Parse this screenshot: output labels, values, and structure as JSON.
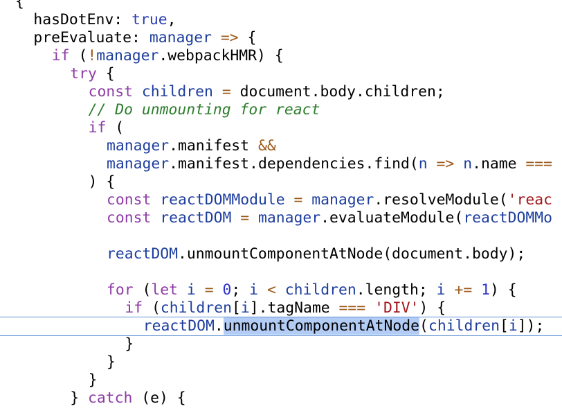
{
  "editor": {
    "colors": {
      "background": "#ffffff",
      "keyword": "#8e3ca6",
      "identifier": "#1d3d9e",
      "atom": "#2c3fb0",
      "operator": "#9c5a1a",
      "number": "#2e33c8",
      "string": "#a0181d",
      "comment": "#2d7d2d",
      "selection": "#b3ccf5",
      "current_line_border": "#5b8fd6"
    },
    "lines": [
      {
        "indent": 0,
        "tokens": [
          {
            "t": "plain",
            "v": "{"
          }
        ]
      },
      {
        "indent": 1,
        "tokens": [
          {
            "t": "plain",
            "v": "hasDotEnv: "
          },
          {
            "t": "atom",
            "v": "true"
          },
          {
            "t": "plain",
            "v": ","
          }
        ]
      },
      {
        "indent": 1,
        "tokens": [
          {
            "t": "plain",
            "v": "preEvaluate: "
          },
          {
            "t": "id",
            "v": "manager"
          },
          {
            "t": "plain",
            "v": " "
          },
          {
            "t": "op",
            "v": "=>"
          },
          {
            "t": "plain",
            "v": " {"
          }
        ]
      },
      {
        "indent": 2,
        "tokens": [
          {
            "t": "kw",
            "v": "if"
          },
          {
            "t": "plain",
            "v": " ("
          },
          {
            "t": "op",
            "v": "!"
          },
          {
            "t": "id",
            "v": "manager"
          },
          {
            "t": "plain",
            "v": ".webpackHMR) {"
          }
        ]
      },
      {
        "indent": 3,
        "tokens": [
          {
            "t": "kw",
            "v": "try"
          },
          {
            "t": "plain",
            "v": " {"
          }
        ]
      },
      {
        "indent": 4,
        "tokens": [
          {
            "t": "kw",
            "v": "const"
          },
          {
            "t": "plain",
            "v": " "
          },
          {
            "t": "id",
            "v": "children"
          },
          {
            "t": "plain",
            "v": " "
          },
          {
            "t": "op",
            "v": "="
          },
          {
            "t": "plain",
            "v": " document.body.children;"
          }
        ]
      },
      {
        "indent": 4,
        "tokens": [
          {
            "t": "cm",
            "v": "// Do unmounting for react"
          }
        ]
      },
      {
        "indent": 4,
        "tokens": [
          {
            "t": "kw",
            "v": "if"
          },
          {
            "t": "plain",
            "v": " ("
          }
        ]
      },
      {
        "indent": 5,
        "tokens": [
          {
            "t": "id",
            "v": "manager"
          },
          {
            "t": "plain",
            "v": ".manifest "
          },
          {
            "t": "op",
            "v": "&&"
          }
        ]
      },
      {
        "indent": 5,
        "tokens": [
          {
            "t": "id",
            "v": "manager"
          },
          {
            "t": "plain",
            "v": ".manifest.dependencies.find("
          },
          {
            "t": "id",
            "v": "n"
          },
          {
            "t": "plain",
            "v": " "
          },
          {
            "t": "op",
            "v": "=>"
          },
          {
            "t": "plain",
            "v": " "
          },
          {
            "t": "id",
            "v": "n"
          },
          {
            "t": "plain",
            "v": ".name "
          },
          {
            "t": "op",
            "v": "==="
          }
        ]
      },
      {
        "indent": 4,
        "tokens": [
          {
            "t": "plain",
            "v": ") {"
          }
        ]
      },
      {
        "indent": 5,
        "tokens": [
          {
            "t": "kw",
            "v": "const"
          },
          {
            "t": "plain",
            "v": " "
          },
          {
            "t": "id",
            "v": "reactDOMModule"
          },
          {
            "t": "plain",
            "v": " "
          },
          {
            "t": "op",
            "v": "="
          },
          {
            "t": "plain",
            "v": " "
          },
          {
            "t": "id",
            "v": "manager"
          },
          {
            "t": "plain",
            "v": ".resolveModule("
          },
          {
            "t": "str",
            "v": "'reac"
          }
        ]
      },
      {
        "indent": 5,
        "tokens": [
          {
            "t": "kw",
            "v": "const"
          },
          {
            "t": "plain",
            "v": " "
          },
          {
            "t": "id",
            "v": "reactDOM"
          },
          {
            "t": "plain",
            "v": " "
          },
          {
            "t": "op",
            "v": "="
          },
          {
            "t": "plain",
            "v": " "
          },
          {
            "t": "id",
            "v": "manager"
          },
          {
            "t": "plain",
            "v": ".evaluateModule("
          },
          {
            "t": "id",
            "v": "reactDOMMo"
          }
        ]
      },
      {
        "indent": 0,
        "tokens": []
      },
      {
        "indent": 5,
        "tokens": [
          {
            "t": "id",
            "v": "reactDOM"
          },
          {
            "t": "plain",
            "v": ".unmountComponentAtNode(document.body);"
          }
        ]
      },
      {
        "indent": 0,
        "tokens": []
      },
      {
        "indent": 5,
        "tokens": [
          {
            "t": "kw",
            "v": "for"
          },
          {
            "t": "plain",
            "v": " ("
          },
          {
            "t": "kw",
            "v": "let"
          },
          {
            "t": "plain",
            "v": " "
          },
          {
            "t": "id",
            "v": "i"
          },
          {
            "t": "plain",
            "v": " "
          },
          {
            "t": "op",
            "v": "="
          },
          {
            "t": "plain",
            "v": " "
          },
          {
            "t": "num",
            "v": "0"
          },
          {
            "t": "plain",
            "v": "; "
          },
          {
            "t": "id",
            "v": "i"
          },
          {
            "t": "plain",
            "v": " "
          },
          {
            "t": "op",
            "v": "<"
          },
          {
            "t": "plain",
            "v": " "
          },
          {
            "t": "id",
            "v": "children"
          },
          {
            "t": "plain",
            "v": ".length; "
          },
          {
            "t": "id",
            "v": "i"
          },
          {
            "t": "plain",
            "v": " "
          },
          {
            "t": "op",
            "v": "+="
          },
          {
            "t": "plain",
            "v": " "
          },
          {
            "t": "num",
            "v": "1"
          },
          {
            "t": "plain",
            "v": ") {"
          }
        ]
      },
      {
        "indent": 6,
        "tokens": [
          {
            "t": "kw",
            "v": "if"
          },
          {
            "t": "plain",
            "v": " ("
          },
          {
            "t": "id",
            "v": "children"
          },
          {
            "t": "plain",
            "v": "["
          },
          {
            "t": "id",
            "v": "i"
          },
          {
            "t": "plain",
            "v": "].tagName "
          },
          {
            "t": "op",
            "v": "==="
          },
          {
            "t": "plain",
            "v": " "
          },
          {
            "t": "str",
            "v": "'DIV'"
          },
          {
            "t": "plain",
            "v": ") {"
          }
        ]
      },
      {
        "indent": 7,
        "current": true,
        "tokens": [
          {
            "t": "id",
            "v": "reactDOM"
          },
          {
            "t": "plain",
            "v": "."
          },
          {
            "t": "sel",
            "v": "unmountComponentAtNode"
          },
          {
            "t": "plain",
            "v": "("
          },
          {
            "t": "id",
            "v": "children"
          },
          {
            "t": "plain",
            "v": "["
          },
          {
            "t": "id",
            "v": "i"
          },
          {
            "t": "plain",
            "v": "]);"
          }
        ]
      },
      {
        "indent": 6,
        "tokens": [
          {
            "t": "plain",
            "v": "}"
          }
        ]
      },
      {
        "indent": 5,
        "tokens": [
          {
            "t": "plain",
            "v": "}"
          }
        ]
      },
      {
        "indent": 4,
        "tokens": [
          {
            "t": "plain",
            "v": "}"
          }
        ]
      },
      {
        "indent": 3,
        "tokens": [
          {
            "t": "plain",
            "v": "} "
          },
          {
            "t": "kw",
            "v": "catch"
          },
          {
            "t": "plain",
            "v": " (e) {"
          }
        ]
      }
    ]
  }
}
